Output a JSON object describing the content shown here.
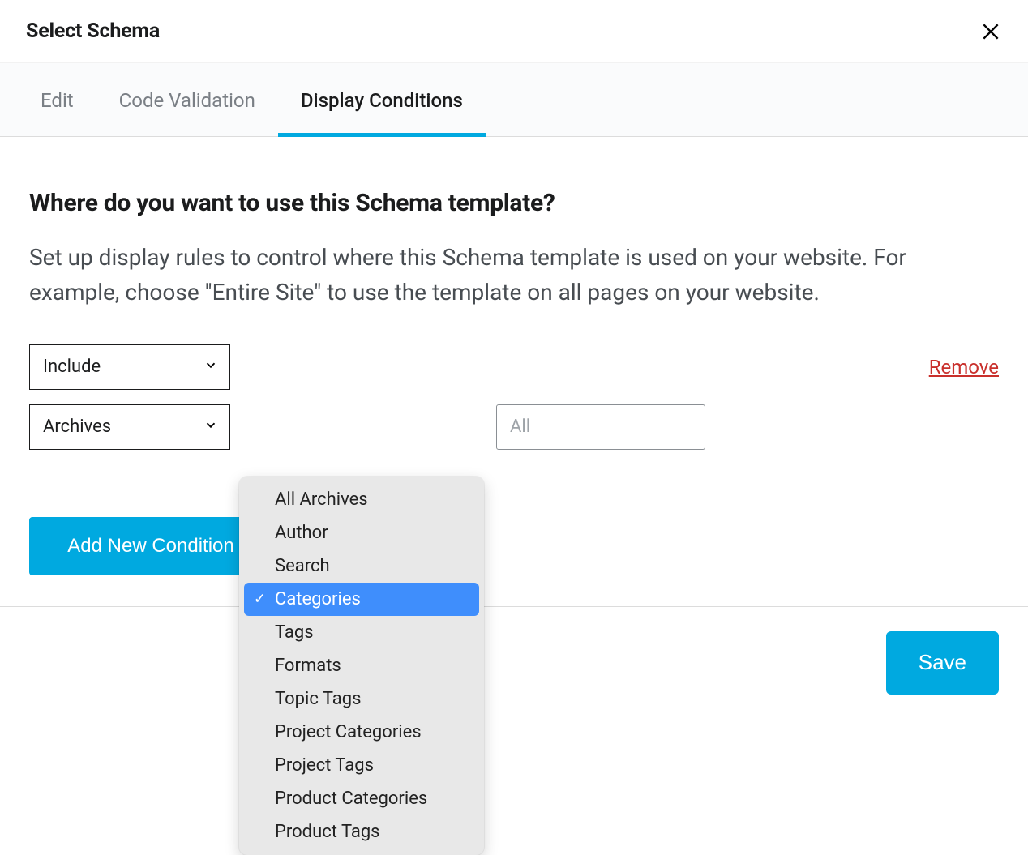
{
  "header": {
    "title": "Select Schema"
  },
  "tabs": [
    {
      "label": "Edit",
      "active": false
    },
    {
      "label": "Code Validation",
      "active": false
    },
    {
      "label": "Display Conditions",
      "active": true
    }
  ],
  "body": {
    "heading": "Where do you want to use this Schema template?",
    "description": "Set up display rules to control where this Schema template is used on your website. For example, choose \"Entire Site\" to use the template on all pages on your website."
  },
  "condition": {
    "include_select": "Include",
    "archive_select": "Archives",
    "target_select": "Categories",
    "value_input_placeholder": "All",
    "remove_label": "Remove"
  },
  "dropdown_options": [
    {
      "label": "All Archives",
      "selected": false
    },
    {
      "label": "Author",
      "selected": false
    },
    {
      "label": "Search",
      "selected": false
    },
    {
      "label": "Categories",
      "selected": true
    },
    {
      "label": "Tags",
      "selected": false
    },
    {
      "label": "Formats",
      "selected": false
    },
    {
      "label": "Topic Tags",
      "selected": false
    },
    {
      "label": "Project Categories",
      "selected": false
    },
    {
      "label": "Project Tags",
      "selected": false
    },
    {
      "label": "Product Categories",
      "selected": false
    },
    {
      "label": "Product Tags",
      "selected": false
    }
  ],
  "buttons": {
    "add_condition": "Add New Condition",
    "save": "Save"
  },
  "colors": {
    "accent": "#00a9e0",
    "dropdown_highlight": "#3f8efc",
    "danger": "#c9302c"
  }
}
